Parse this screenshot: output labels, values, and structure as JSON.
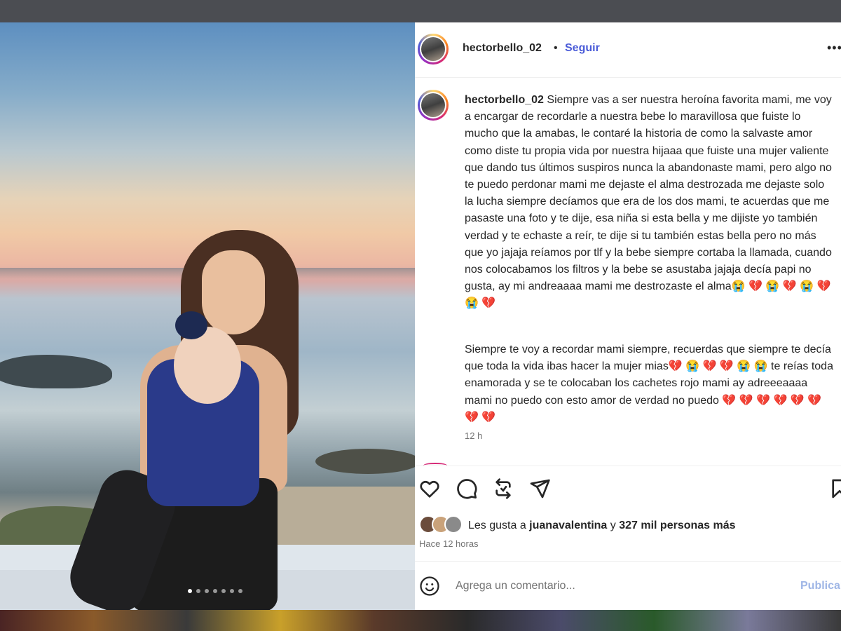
{
  "header": {
    "username": "hectorbello_02",
    "separator": "•",
    "follow_label": "Seguir",
    "more_label": "•••"
  },
  "caption": {
    "username": "hectorbello_02",
    "text": "Siempre vas a ser nuestra heroína favorita mami, me voy a encargar de recordarle a nuestra bebe lo maravillosa que fuiste lo mucho que la amabas, le contaré la historia de como la salvaste amor como diste tu propia vida por nuestra hijaaa que fuiste una mujer valiente que dando tus últimos suspiros nunca la abandonaste mami, pero algo no te puedo perdonar mami me dejaste el alma destrozada me dejaste solo la lucha siempre decíamos que era de los dos mami, te acuerdas que me pasaste una foto y te dije, esa niña si esta bella y me dijiste yo también verdad y te echaste a reír, te dije si tu también estas bella pero no más que yo jajaja reíamos por tlf y la bebe siempre cortaba la llamada, cuando nos colocabamos los filtros y la bebe se asustaba jajaja decía papi no gusta, ay mi andreaaaa mami me destrozaste el alma😭 💔 😭 💔 😭 💔 😭 💔",
    "paragraph2": "Siempre te voy a recordar mami siempre, recuerdas que siempre te decía que toda la vida ibas hacer la mujer mias💔 😭 💔 💔 😭 😭 te reías toda enamorada y se te colocaban los cachetes rojo mami ay adreeeaaaa mami no puedo con esto amor de verdad no puedo 💔 💔 💔 💔 💔 💔 💔 💔",
    "timestamp": "12 h"
  },
  "actions": {
    "like_icon": "heart-icon",
    "comment_icon": "comment-icon",
    "share_icon": "repost-icon",
    "send_icon": "send-icon",
    "save_icon": "bookmark-icon"
  },
  "likes": {
    "prefix": "Les gusta a ",
    "user": "juanavalentina",
    "mid": " y ",
    "count": "327 mil personas más",
    "time_ago": "Hace 12 horas"
  },
  "comment": {
    "placeholder": "Agrega un comentario...",
    "publish_label": "Publicar"
  },
  "carousel": {
    "total": 7,
    "active": 1
  },
  "colors": {
    "accent": "#4a5bd8",
    "text": "#262626",
    "muted": "#737373",
    "publish_disabled": "#9fb6e6"
  }
}
